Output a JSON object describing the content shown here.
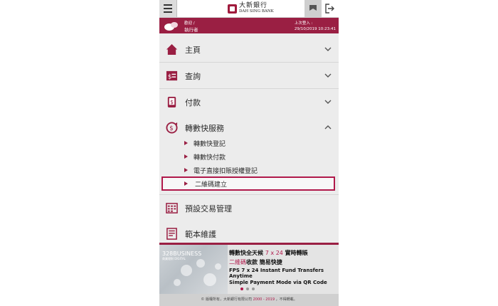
{
  "header": {
    "logo_cn": "大新銀行",
    "logo_en": "DAH SING BANK"
  },
  "welcome": {
    "greeting": "歡迎 /",
    "name": "執行者",
    "last_login_label": "上次登入 :",
    "last_login_time": "29/10/2019 10:23:41"
  },
  "menu": {
    "items": [
      {
        "label": "主頁",
        "icon": "home-icon"
      },
      {
        "label": "查詢",
        "icon": "inquiry-icon"
      },
      {
        "label": "付款",
        "icon": "payment-icon"
      },
      {
        "label": "轉數快服務",
        "icon": "fps-icon"
      },
      {
        "label": "預設交易管理",
        "icon": "calendar-icon"
      },
      {
        "label": "範本維護",
        "icon": "template-icon"
      }
    ],
    "fps_sub_items": [
      {
        "label": "轉數快登記"
      },
      {
        "label": "轉數快付款"
      },
      {
        "label": "電子直接扣賬授權登記"
      },
      {
        "label": "二維碼建立"
      }
    ]
  },
  "banner": {
    "brand": "328BUSINESS",
    "brand_sub": "商業理財 DIGITAL",
    "line1_a": "轉數快全天候 ",
    "line1_b": "7 x 24",
    "line1_c": " 實時轉賬",
    "line2_a": "二維碼",
    "line2_b": "收款  簡易快捷",
    "line3_a": "FPS ",
    "line3_b": "7 x 24",
    "line3_c": " Instant Fund Transfers Anytime",
    "line4_a": "Simple Payment Mode via ",
    "line4_b": "QR Code"
  },
  "footer": {
    "prefix": "© 版權所有，大新銀行有限公司 ",
    "years": "2000 - 2019",
    "suffix": " ，不得轉載。"
  },
  "colors": {
    "brand": "#9a1f43",
    "accent": "#b0184a",
    "menu_bg": "#ececec"
  }
}
